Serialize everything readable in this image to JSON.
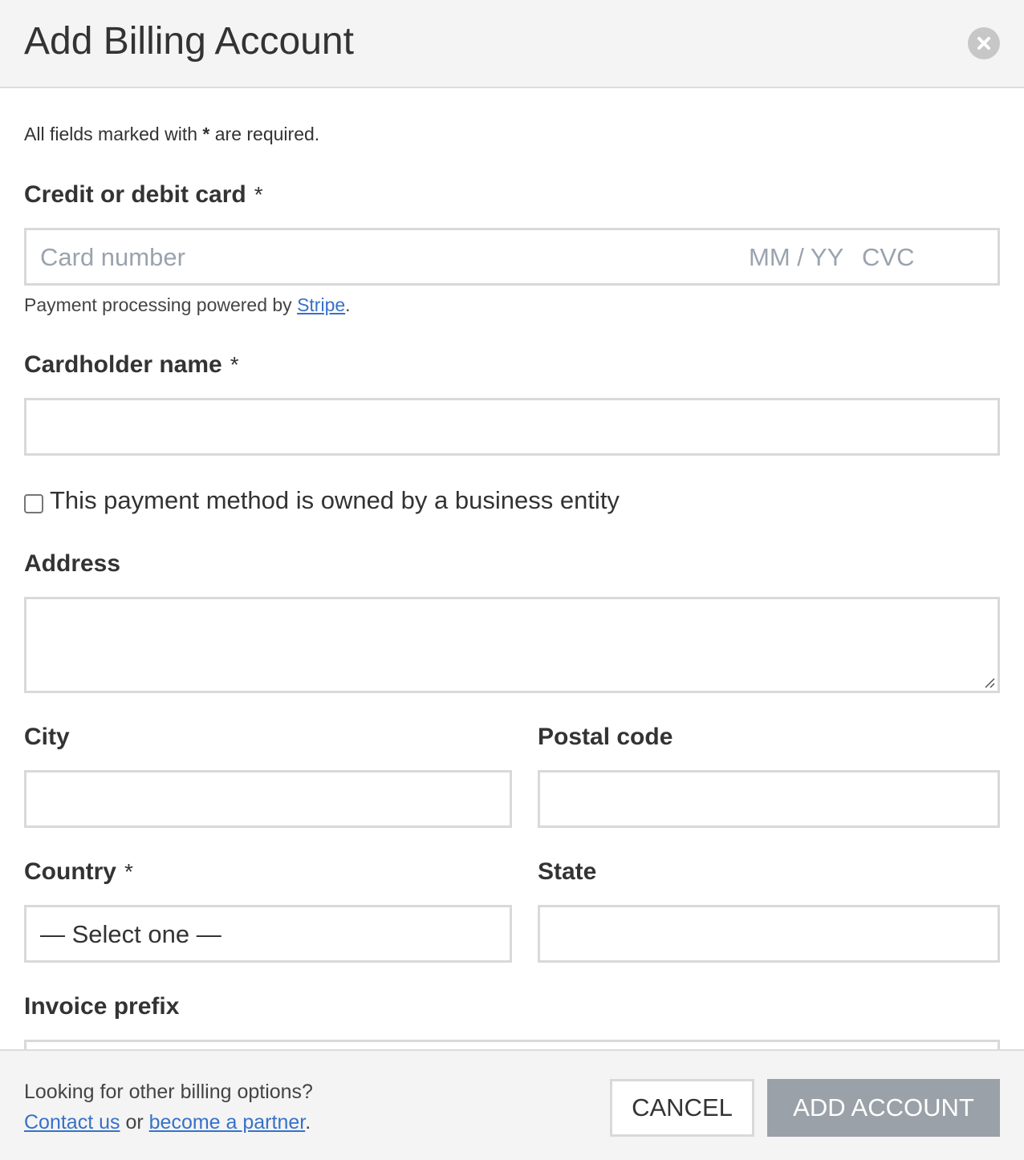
{
  "dialog": {
    "title": "Add Billing Account",
    "close_icon": "close-icon"
  },
  "form": {
    "required_note_prefix": "All fields marked with ",
    "required_note_star": "*",
    "required_note_suffix": " are required.",
    "required_marker": "*",
    "card": {
      "label": "Credit or debit card",
      "number_placeholder": "Card number",
      "expiry_placeholder": "MM / YY",
      "cvc_placeholder": "CVC",
      "powered_prefix": "Payment processing powered by ",
      "powered_link": "Stripe",
      "powered_suffix": "."
    },
    "cardholder": {
      "label": "Cardholder name",
      "value": ""
    },
    "business_checkbox": {
      "label": "This payment method is owned by a business entity",
      "checked": false
    },
    "address": {
      "label": "Address",
      "value": ""
    },
    "city": {
      "label": "City",
      "value": ""
    },
    "postal_code": {
      "label": "Postal code",
      "value": ""
    },
    "country": {
      "label": "Country",
      "selected": "— Select one —"
    },
    "state": {
      "label": "State",
      "value": ""
    },
    "invoice_prefix": {
      "label": "Invoice prefix",
      "value": ""
    }
  },
  "footer": {
    "question": "Looking for other billing options?",
    "contact_link": "Contact us",
    "or_text": " or ",
    "partner_link": "become a partner",
    "end_text": ".",
    "cancel_label": "CANCEL",
    "add_label": "ADD ACCOUNT"
  }
}
